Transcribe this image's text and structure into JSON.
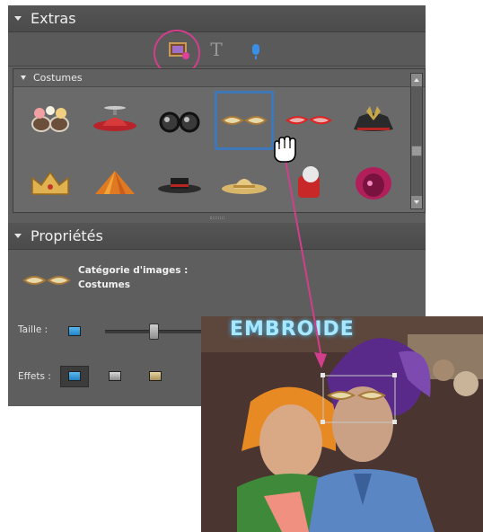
{
  "extras": {
    "title": "Extras",
    "modes": [
      {
        "name": "graphics",
        "icon": "graphics-icon",
        "active": true
      },
      {
        "name": "text",
        "icon": "text-tool-icon",
        "glyph": "T"
      },
      {
        "name": "audio",
        "icon": "microphone-icon"
      }
    ],
    "costumes": {
      "label": "Costumes",
      "items": [
        {
          "icon": "flower-glasses-icon"
        },
        {
          "icon": "propeller-hat-icon"
        },
        {
          "icon": "round-glasses-icon"
        },
        {
          "icon": "cat-eye-glasses-icon",
          "selected": true
        },
        {
          "icon": "red-glasses-icon"
        },
        {
          "icon": "pirate-hat-icon"
        },
        {
          "icon": "crown-icon"
        },
        {
          "icon": "tent-hat-icon"
        },
        {
          "icon": "flat-hat-icon"
        },
        {
          "icon": "straw-hat-icon"
        },
        {
          "icon": "red-hat-icon"
        },
        {
          "icon": "feather-hat-icon"
        }
      ]
    }
  },
  "properties": {
    "title": "Propriétés",
    "category_line1": "Catégorie d'images :",
    "category_line2": "Costumes",
    "size_label": "Taille :",
    "effects_label": "Effets :",
    "size_value": 0.45
  },
  "photo": {
    "sign_text": "EMBROIDE"
  },
  "colors": {
    "panel_bg": "#5e5e5e",
    "highlight": "#d13f8c",
    "selection": "#3e78b9"
  }
}
